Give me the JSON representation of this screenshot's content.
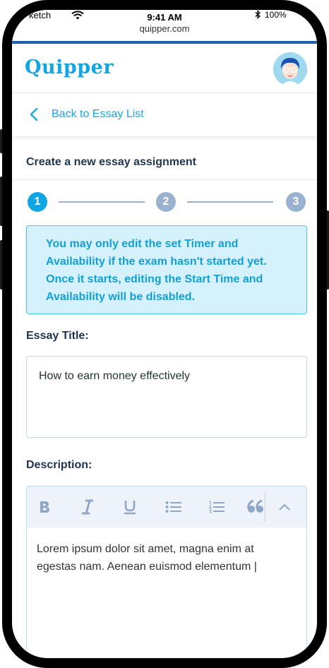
{
  "status_bar": {
    "carrier": "ketch",
    "time": "9:41 AM",
    "url": "quipper.com",
    "battery": "100%"
  },
  "app": {
    "logo": "Quipper",
    "avatar_icon": "user-avatar-icon"
  },
  "nav": {
    "back_label": "Back to Essay List"
  },
  "form": {
    "title": "Create a new essay assignment",
    "steps": [
      "1",
      "2",
      "3"
    ],
    "active_step": 1,
    "info_message": "You may only edit the set Timer and Availability if the exam hasn't started yet. Once it starts, editing the Start Time and Availability will be disabled.",
    "essay_title_label": "Essay Title:",
    "essay_title_value": "How to earn money effectively",
    "description_label": "Description:",
    "description_value": "Lorem ipsum dolor sit amet, magna enim at egestas nam. Aenean euismod elementum |"
  },
  "toolbar": {
    "icons": [
      "bold-icon",
      "italic-icon",
      "underline-icon",
      "bullet-list-icon",
      "numbered-list-icon",
      "quote-icon",
      "chevron-up-icon"
    ]
  },
  "colors": {
    "brand": "#12a5e6",
    "info_bg": "#d5f2fc",
    "heading": "#1e3450",
    "step_inactive": "#9ab1cf"
  }
}
